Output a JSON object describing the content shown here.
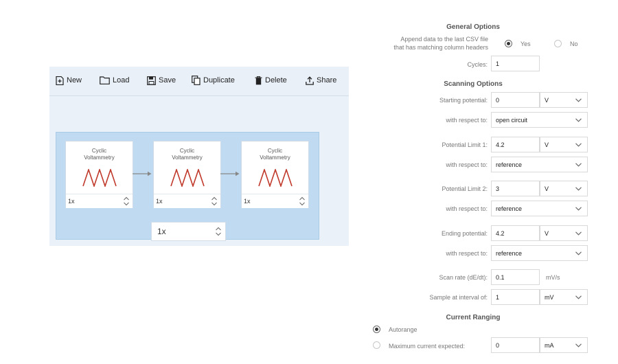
{
  "toolbar": {
    "new_label": "New",
    "load_label": "Load",
    "save_label": "Save",
    "duplicate_label": "Duplicate",
    "delete_label": "Delete",
    "share_label": "Share"
  },
  "sequence": {
    "steps": [
      {
        "title_line1": "Cyclic",
        "title_line2": "Voltammetry",
        "count": "1x"
      },
      {
        "title_line1": "Cyclic",
        "title_line2": "Voltammetry",
        "count": "1x"
      },
      {
        "title_line1": "Cyclic",
        "title_line2": "Voltammetry",
        "count": "1x"
      }
    ],
    "repeat_count": "1x"
  },
  "general": {
    "title": "General Options",
    "append_label_line1": "Append data to the last CSV file",
    "append_label_line2": "that has matching column headers",
    "yes_label": "Yes",
    "no_label": "No",
    "append_selected": "Yes",
    "cycles_label": "Cycles:",
    "cycles_value": "1"
  },
  "scanning": {
    "title": "Scanning Options",
    "starting_potential_label": "Starting potential:",
    "starting_potential_value": "0",
    "starting_potential_unit": "V",
    "starting_respect_label": "with respect to:",
    "starting_respect_value": "open circuit",
    "limit1_label": "Potential Limit 1:",
    "limit1_value": "4.2",
    "limit1_unit": "V",
    "limit1_respect_label": "with respect to:",
    "limit1_respect_value": "reference",
    "limit2_label": "Potential Limit 2:",
    "limit2_value": "3",
    "limit2_unit": "V",
    "limit2_respect_label": "with respect to:",
    "limit2_respect_value": "reference",
    "ending_potential_label": "Ending potential:",
    "ending_potential_value": "4.2",
    "ending_potential_unit": "V",
    "ending_respect_label": "with respect to:",
    "ending_respect_value": "reference",
    "scan_rate_label": "Scan rate (dE/dt):",
    "scan_rate_value": "0.1",
    "scan_rate_unit": "mV/s",
    "sample_interval_label": "Sample at interval of:",
    "sample_interval_value": "1",
    "sample_interval_unit": "mV"
  },
  "current": {
    "title": "Current Ranging",
    "autorange_label": "Autorange",
    "max_current_label": "Maximum current expected:",
    "max_current_value": "0",
    "max_current_unit": "mA",
    "selected": "Autorange"
  },
  "colors": {
    "wave": "#c0392b",
    "sequence_bg": "#bfdaf1",
    "editor_bg": "#eaf1f9"
  }
}
